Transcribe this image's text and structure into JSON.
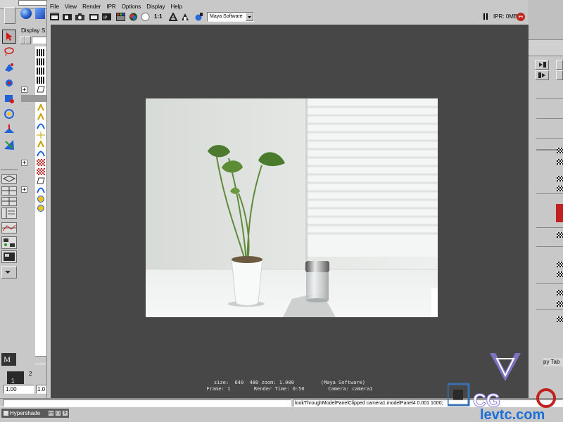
{
  "main_window": {
    "display_tab": "Display",
    "display_tab_2": "S",
    "frame_current": "1",
    "frame_next": "2",
    "range_start": "1.00",
    "range_end": "1.0",
    "hypershade_label": "Hypershade"
  },
  "render_view": {
    "menu": [
      "File",
      "View",
      "Render",
      "IPR",
      "Options",
      "Display",
      "Help"
    ],
    "ratio_label": "1:1",
    "renderer": "Maya Software",
    "ipr_status": "IPR: 0MB",
    "ipr_badge": "IPR",
    "info_line1": "size:  640  480 zoom: 1.000         (Maya Software)",
    "info_line2": "Frame: 1        Render Time: 0:50        Camera: camera1"
  },
  "command_line": {
    "feedback": "lookThroughModelPanelClipped camera1 modelPanel4 0.001 1000;"
  },
  "right_panel": {
    "tab_label": "py Tab"
  },
  "watermark": {
    "logo_text": "CG",
    "site_text": "levtc.com"
  },
  "colors": {
    "ui_gray": "#c8c8c8",
    "render_bg": "#474747",
    "ipr_red": "#c0281e"
  }
}
